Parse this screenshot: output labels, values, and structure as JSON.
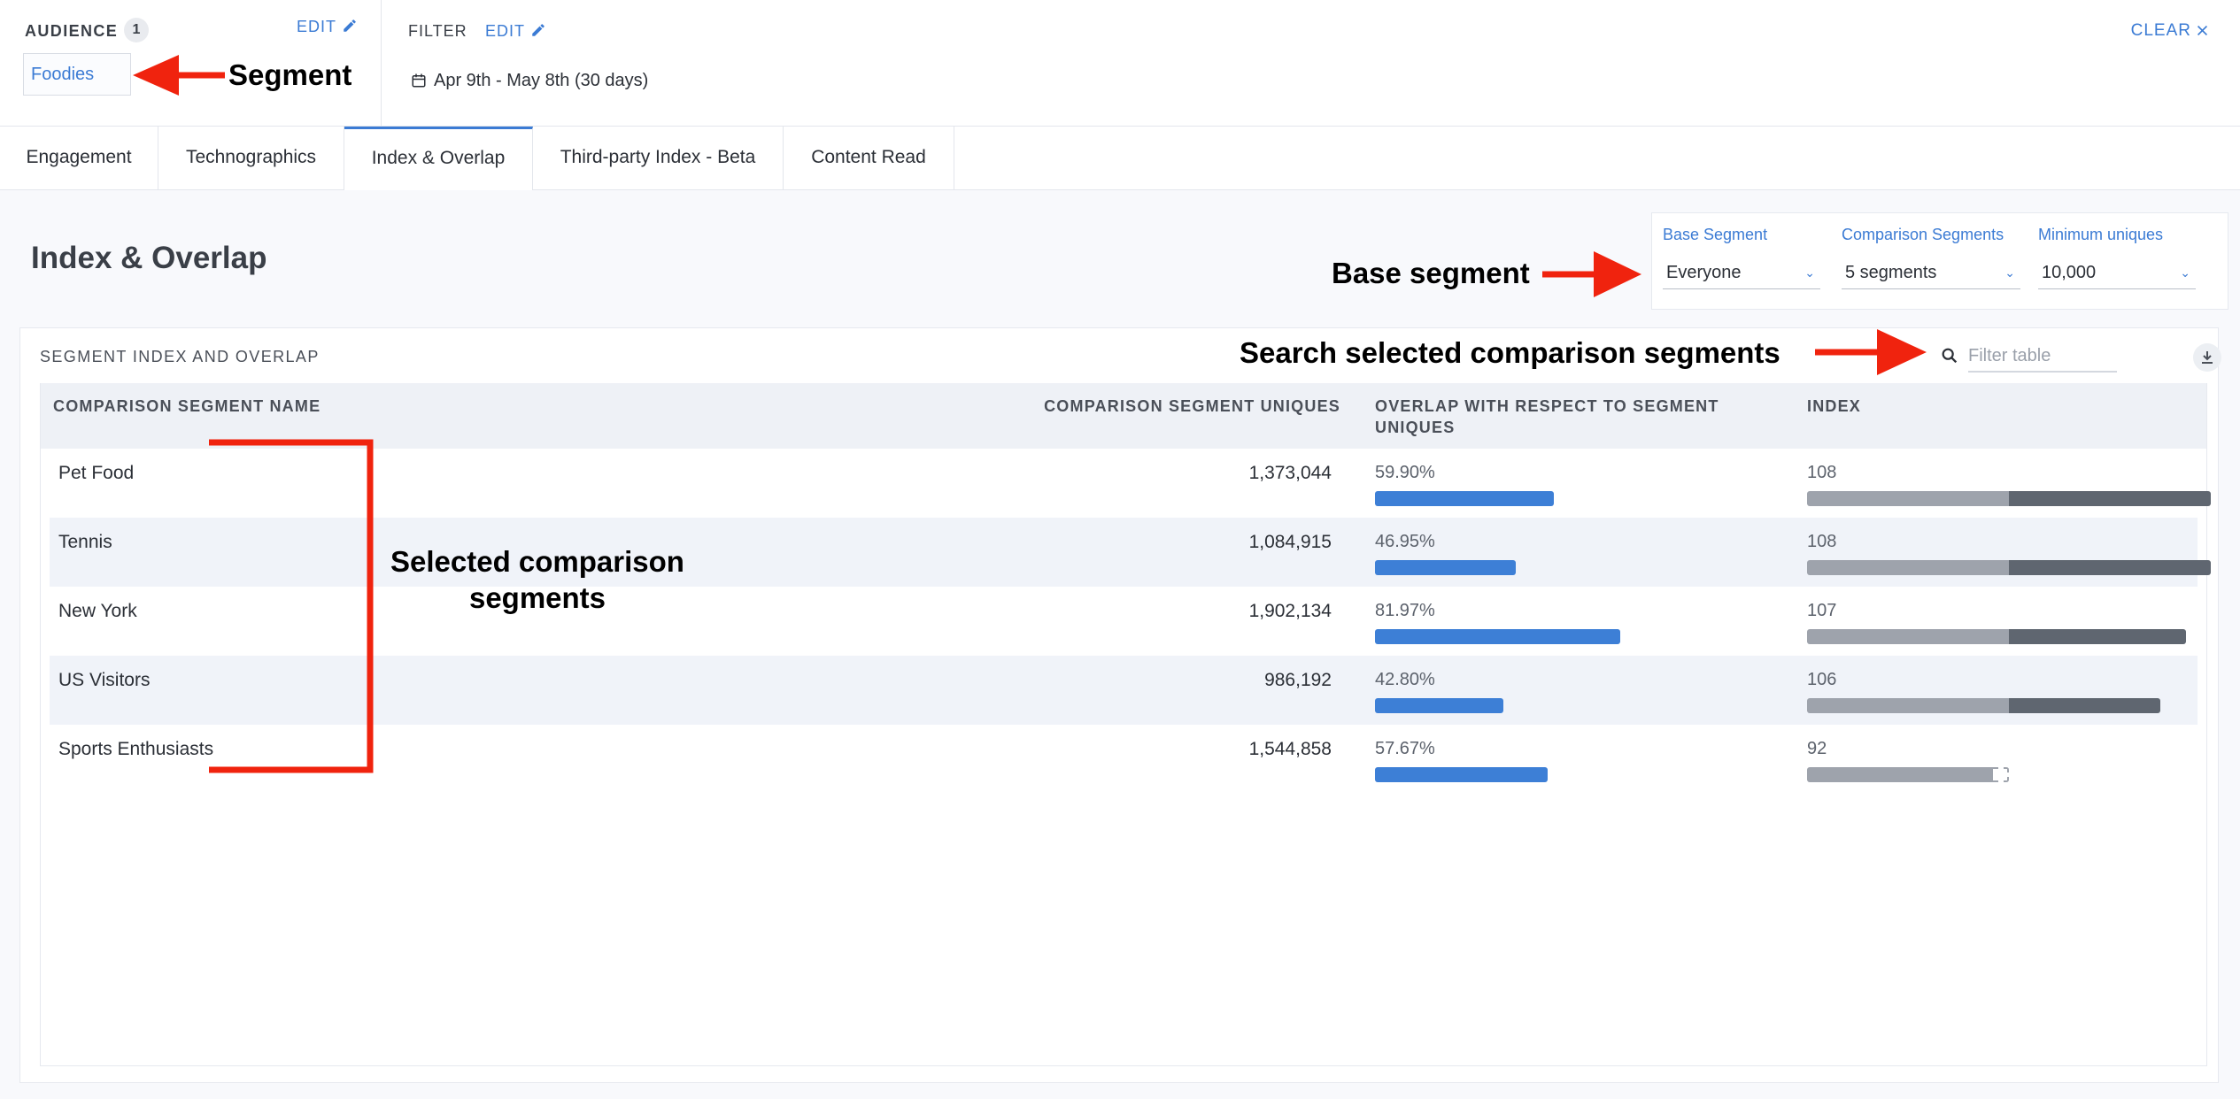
{
  "audience": {
    "label": "AUDIENCE",
    "count": "1",
    "edit_label": "EDIT",
    "segment": "Foodies"
  },
  "filter": {
    "label": "FILTER",
    "edit_label": "EDIT",
    "date_range": "Apr 9th - May 8th (30 days)"
  },
  "clear_label": "CLEAR",
  "tabs": [
    {
      "label": "Engagement"
    },
    {
      "label": "Technographics"
    },
    {
      "label": "Index & Overlap",
      "active": true
    },
    {
      "label": "Third-party Index - Beta"
    },
    {
      "label": "Content Read"
    }
  ],
  "page_title": "Index & Overlap",
  "controls": {
    "base_segment": {
      "label": "Base Segment",
      "value": "Everyone"
    },
    "comparison_segments": {
      "label": "Comparison Segments",
      "value": "5 segments"
    },
    "minimum_uniques": {
      "label": "Minimum uniques",
      "value": "10,000"
    }
  },
  "panel": {
    "title": "SEGMENT INDEX AND OVERLAP",
    "filter_placeholder": "Filter table",
    "columns": [
      "COMPARISON SEGMENT NAME",
      "COMPARISON SEGMENT UNIQUES",
      "OVERLAP WITH RESPECT TO SEGMENT UNIQUES",
      "INDEX"
    ],
    "rows": [
      {
        "name": "Pet Food",
        "uniques": "1,373,044",
        "overlap": "59.90%",
        "overlap_value": 59.9,
        "index": "108",
        "index_value": 108
      },
      {
        "name": "Tennis",
        "uniques": "1,084,915",
        "overlap": "46.95%",
        "overlap_value": 46.95,
        "index": "108",
        "index_value": 108
      },
      {
        "name": "New York",
        "uniques": "1,902,134",
        "overlap": "81.97%",
        "overlap_value": 81.97,
        "index": "107",
        "index_value": 107
      },
      {
        "name": "US Visitors",
        "uniques": "986,192",
        "overlap": "42.80%",
        "overlap_value": 42.8,
        "index": "106",
        "index_value": 106
      },
      {
        "name": "Sports Enthusiasts",
        "uniques": "1,544,858",
        "overlap": "57.67%",
        "overlap_value": 57.67,
        "index": "92",
        "index_value": 92
      }
    ]
  },
  "annotations": {
    "segment": "Segment",
    "base_segment": "Base segment",
    "search": "Search selected comparison segments",
    "selected_line1": "Selected comparison",
    "selected_line2": "segments"
  },
  "colors": {
    "accent": "#3b7bd4",
    "overlap_bar": "#3d7fd6",
    "index_base": "#9ea3ac",
    "index_over": "#5f6670",
    "annotation_red": "#f0230e"
  }
}
